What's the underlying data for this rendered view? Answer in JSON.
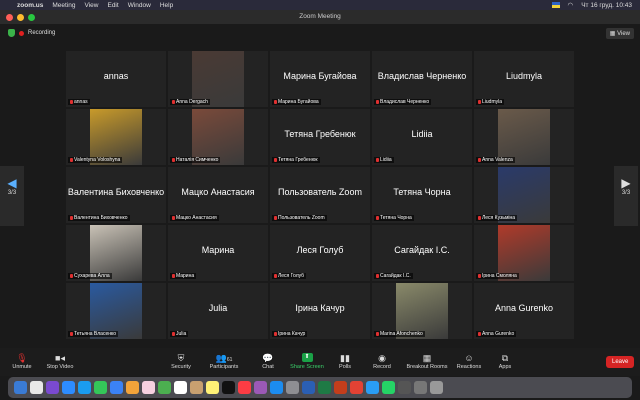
{
  "menubar": {
    "app": "zoom.us",
    "items": [
      "Meeting",
      "View",
      "Edit",
      "Window",
      "Help"
    ],
    "datetime": "Чт 16 груд.  10:43"
  },
  "window": {
    "title": "Zoom Meeting"
  },
  "top": {
    "recording": "Recording",
    "view": "View"
  },
  "nav": {
    "page": "3/3"
  },
  "tiles": [
    {
      "big": "annas",
      "label": "annas"
    },
    {
      "big": "",
      "label": "Anna Dergach",
      "photo": "#4a3a34"
    },
    {
      "big": "Марина Бугайова",
      "label": "Марина Бугайова"
    },
    {
      "big": "Владислав Черненко",
      "label": "Владислав Черненко"
    },
    {
      "big": "Liudmyla",
      "label": "Liudmyla"
    },
    {
      "big": "",
      "label": "Valentyna Voloshyna",
      "photo": "#c89a2a"
    },
    {
      "big": "",
      "label": "Наталія Симченко",
      "photo": "#7a4a3a"
    },
    {
      "big": "Тетяна Гребенюк",
      "label": "Тетяна Гребенюк"
    },
    {
      "big": "Lidiia",
      "label": "Lidiia"
    },
    {
      "big": "",
      "label": "Anna Valenza",
      "photo": "#6a5a4a"
    },
    {
      "big": "Валентина Биховченко",
      "label": "Валентина Биховченко"
    },
    {
      "big": "Мацко Анастасия",
      "label": "Мацко Анастасия"
    },
    {
      "big": "Пользователь Zoom",
      "label": "Пользователь Zoom"
    },
    {
      "big": "Тетяна Чорна",
      "label": "Тетяна Чорна"
    },
    {
      "big": "",
      "label": "Леся Кузьміна",
      "photo": "#2a3a6a"
    },
    {
      "big": "",
      "label": "Сухарева Алла",
      "photo": "#c9c2b6"
    },
    {
      "big": "Марина",
      "label": "Марина"
    },
    {
      "big": "Леся Голуб",
      "label": "Леся Голуб"
    },
    {
      "big": "Сагайдак І.С.",
      "label": "Сагайдак І.С."
    },
    {
      "big": "",
      "label": "Ірина Смоляна",
      "photo": "#b03a2a"
    },
    {
      "big": "",
      "label": "Тетьяна Власенко",
      "photo": "#2a5aa0"
    },
    {
      "big": "Julia",
      "label": "Julia"
    },
    {
      "big": "Ірина Качур",
      "label": "Ірина Качур"
    },
    {
      "big": "",
      "label": "Marina Afonchenko",
      "photo": "#8a8a6a"
    },
    {
      "big": "Anna Gurenko",
      "label": "Anna Gurenko"
    }
  ],
  "toolbar": {
    "unmute": "Unmute",
    "stop_video": "Stop Video",
    "security": "Security",
    "participants": "Participants",
    "participants_count": "61",
    "chat": "Chat",
    "share": "Share Screen",
    "polls": "Polls",
    "record": "Record",
    "breakout": "Breakout Rooms",
    "reactions": "Reactions",
    "apps": "Apps",
    "leave": "Leave"
  },
  "colors": {
    "share_green": "#1aa147",
    "leave_red": "#d62424",
    "mic_red": "#e03030"
  }
}
